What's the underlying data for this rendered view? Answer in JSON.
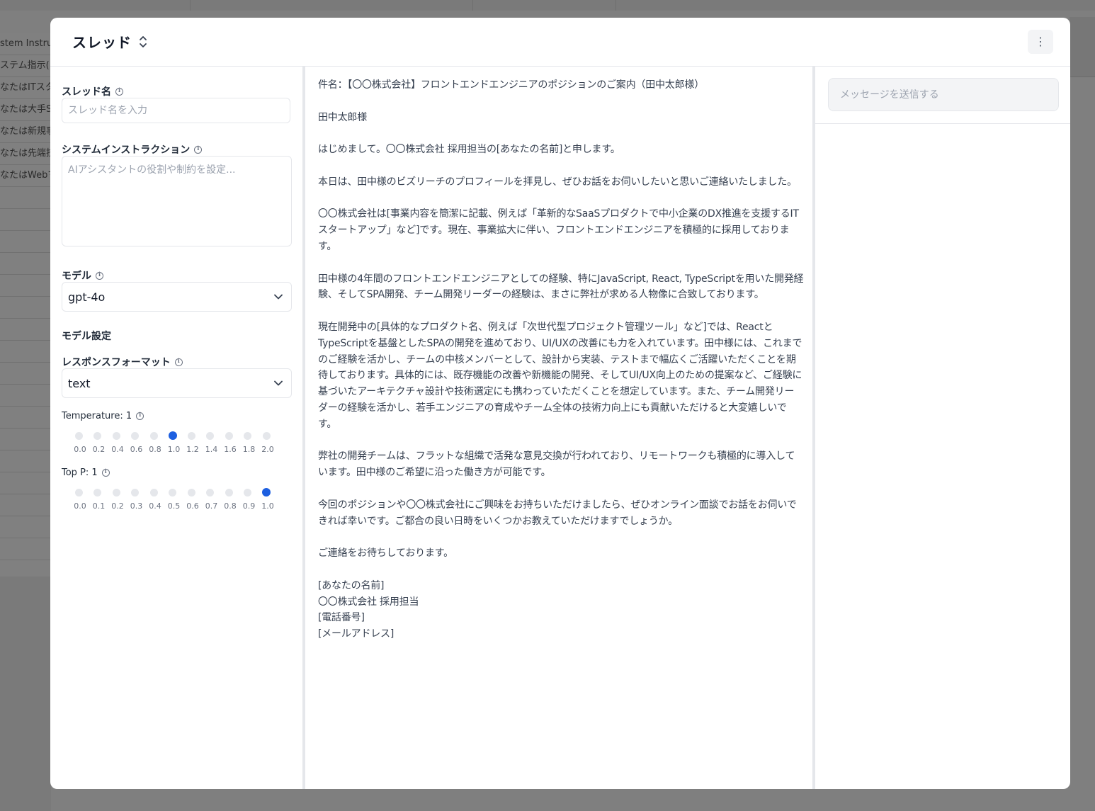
{
  "background": {
    "rows": [
      "stem Instru",
      "ステム指示(ト",
      "なたはITスタ",
      "なたは大手Sa",
      "なたは新規事",
      "なたは先端技",
      "なたはWebマ"
    ]
  },
  "modal": {
    "title": "スレッド",
    "menu_icon": "kebab-menu-icon"
  },
  "settings": {
    "thread_name_label": "スレッド名",
    "thread_name_placeholder": "スレッド名を入力",
    "system_instruction_label": "システムインストラクション",
    "system_instruction_placeholder": "AIアシスタントの役割や制約を設定...",
    "model_label": "モデル",
    "model_value": "gpt-4o",
    "model_settings_heading": "モデル設定",
    "response_format_label": "レスポンスフォーマット",
    "response_format_value": "text",
    "temperature_label": "Temperature: 1",
    "temperature_ticks": [
      "0.0",
      "0.2",
      "0.4",
      "0.6",
      "0.8",
      "1.0",
      "1.2",
      "1.4",
      "1.6",
      "1.8",
      "2.0"
    ],
    "temperature_selected": 1.0,
    "top_p_label": "Top P: 1",
    "top_p_ticks": [
      "0.0",
      "0.1",
      "0.2",
      "0.3",
      "0.4",
      "0.5",
      "0.6",
      "0.7",
      "0.8",
      "0.9",
      "1.0"
    ],
    "top_p_selected": 1.0
  },
  "content": {
    "paragraphs": [
      "件名：【〇〇株式会社】フロントエンドエンジニアのポジションのご案内（田中太郎様）",
      "田中太郎様",
      "はじめまして。〇〇株式会社 採用担当の[あなたの名前]と申します。",
      "本日は、田中様のビズリーチのプロフィールを拝見し、ぜひお話をお伺いしたいと思いご連絡いたしました。",
      "〇〇株式会社は[事業内容を簡潔に記載、例えば「革新的なSaaSプロダクトで中小企業のDX推進を支援するITスタートアップ」など]です。現在、事業拡大に伴い、フロントエンドエンジニアを積極的に採用しております。",
      "田中様の4年間のフロントエンドエンジニアとしての経験、特にJavaScript, React, TypeScriptを用いた開発経験、そしてSPA開発、チーム開発リーダーの経験は、まさに弊社が求める人物像に合致しております。",
      "現在開発中の[具体的なプロダクト名、例えば「次世代型プロジェクト管理ツール」など]では、ReactとTypeScriptを基盤としたSPAの開発を進めており、UI/UXの改善にも力を入れています。田中様には、これまでのご経験を活かし、チームの中核メンバーとして、設計から実装、テストまで幅広くご活躍いただくことを期待しております。具体的には、既存機能の改善や新機能の開発、そしてUI/UX向上のための提案など、ご経験に基づいたアーキテクチャ設計や技術選定にも携わっていただくことを想定しています。また、チーム開発リーダーの経験を活かし、若手エンジニアの育成やチーム全体の技術力向上にも貢献いただけると大変嬉しいです。",
      "弊社の開発チームは、フラットな組織で活発な意見交換が行われており、リモートワークも積極的に導入しています。田中様のご希望に沿った働き方が可能です。",
      "今回のポジションや〇〇株式会社にご興味をお持ちいただけましたら、ぜひオンライン面談でお話をお伺いできれば幸いです。ご都合の良い日時をいくつかお教えていただけますでしょうか。",
      "ご連絡をお待ちしております。"
    ],
    "signature": [
      "[あなたの名前]",
      "〇〇株式会社 採用担当",
      "[電話番号]",
      "[メールアドレス]"
    ]
  },
  "chat": {
    "placeholder": "メッセージを送信する"
  }
}
